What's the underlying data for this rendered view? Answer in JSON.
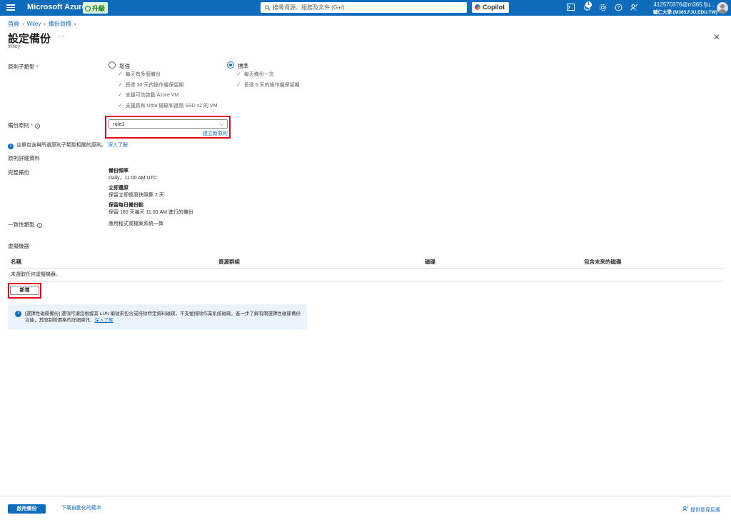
{
  "topbar": {
    "brand": "Microsoft Azure",
    "upgrade_label": "升級",
    "search_placeholder": "搜尋資源、服務及文件 (G+/)",
    "copilot_label": "Copilot",
    "notification_count": "1",
    "account_email": "412570376@m365.fju...",
    "account_org": "輔仁大學 (M365.FJU.EDU.TW)"
  },
  "breadcrumb": [
    "首頁",
    "Wiley",
    "備份目標"
  ],
  "page": {
    "title": "設定備份",
    "subtitle": "Wiley",
    "more": "···"
  },
  "policy_subtype": {
    "label": "原則子類型",
    "options": [
      {
        "label": "增強",
        "selected": false,
        "features": [
          "每天有多個備份",
          "長達 30 天的操作層保留期",
          "支援可信啟動 Azure VM",
          "支援具有 Ultra 磁碟和進階 SSD v2 的 VM"
        ]
      },
      {
        "label": "標準",
        "selected": true,
        "features": [
          "每天備份一次",
          "長達 5 天的操作層保留期"
        ]
      }
    ]
  },
  "backup_policy": {
    "label": "備份原則",
    "value": "rule1",
    "create_link": "建立新原則"
  },
  "info_line": {
    "text": "這單包含與所選原則子類型相關的原則。",
    "link": "深入了解"
  },
  "policy_details": {
    "heading": "原則詳細資料",
    "full_backup_label": "完整備份",
    "frequency_title": "備份頻率",
    "frequency_value": "Daily，11:00 AM UTC",
    "instant_restore_title": "立即還原",
    "instant_restore_value": "保留立即復原快照集 2 天",
    "daily_retention_title": "保留每日備份點",
    "daily_retention_value": "保留 180 天每天 11:00 AM 進行的備份",
    "consistency_label": "一致性類型",
    "consistency_value": "應用程式或檔案系統一致"
  },
  "vms": {
    "heading": "虛擬機器",
    "columns": [
      "名稱",
      "資源群組",
      "磁碟",
      "包含未來的磁碟"
    ],
    "empty_text": "未選取任何虛擬機器。",
    "add_button": "新增"
  },
  "notice": {
    "text": "[選擇性磁碟備份] 選項可讓您根據其 LUN 編號來包含或排除特定資料磁碟，不支援排除作業系統磁碟。進一步了解有關選擇性磁碟備份功能，其限制和價格的詳細資訊，",
    "link": "深入了解"
  },
  "footer": {
    "enable_button": "啟用備份",
    "download_link": "下載自動化的範本",
    "feedback_link": "提供意見反應"
  },
  "colors": {
    "brand": "#0f6cbd",
    "highlight": "#e00b1c"
  }
}
